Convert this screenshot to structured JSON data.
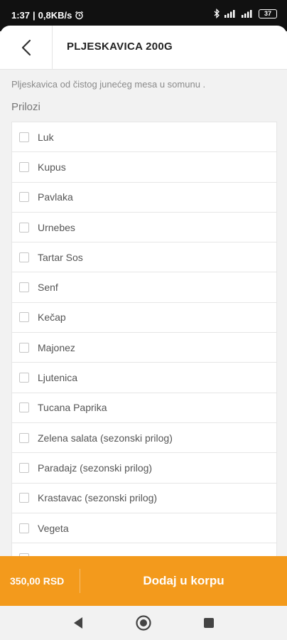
{
  "status": {
    "time": "1:37",
    "network_speed": "0,8KB/s",
    "battery": "37"
  },
  "header": {
    "title": "PLJESKAVICA 200G"
  },
  "product": {
    "description": "Pljeskavica od čistog junećeg mesa u somunu ."
  },
  "options_section": {
    "title": "Prilozi",
    "items": [
      {
        "label": "Luk",
        "checked": false
      },
      {
        "label": "Kupus",
        "checked": false
      },
      {
        "label": "Pavlaka",
        "checked": false
      },
      {
        "label": "Urnebes",
        "checked": false
      },
      {
        "label": "Tartar Sos",
        "checked": false
      },
      {
        "label": "Senf",
        "checked": false
      },
      {
        "label": "Kečap",
        "checked": false
      },
      {
        "label": "Majonez",
        "checked": false
      },
      {
        "label": "Ljutenica",
        "checked": false
      },
      {
        "label": "Tucana Paprika",
        "checked": false
      },
      {
        "label": "Zelena salata (sezonski prilog)",
        "checked": false
      },
      {
        "label": "Paradajz (sezonski prilog)",
        "checked": false
      },
      {
        "label": "Krastavac (sezonski prilog)",
        "checked": false
      },
      {
        "label": "Vegeta",
        "checked": false
      },
      {
        "label": "",
        "checked": false
      }
    ]
  },
  "cart_bar": {
    "price": "350,00 RSD",
    "add_label": "Dodaj u korpu",
    "accent_color": "#f39a1c"
  },
  "navigation": {
    "icons": [
      "back-triangle-icon",
      "home-circle-icon",
      "recents-square-icon"
    ]
  }
}
